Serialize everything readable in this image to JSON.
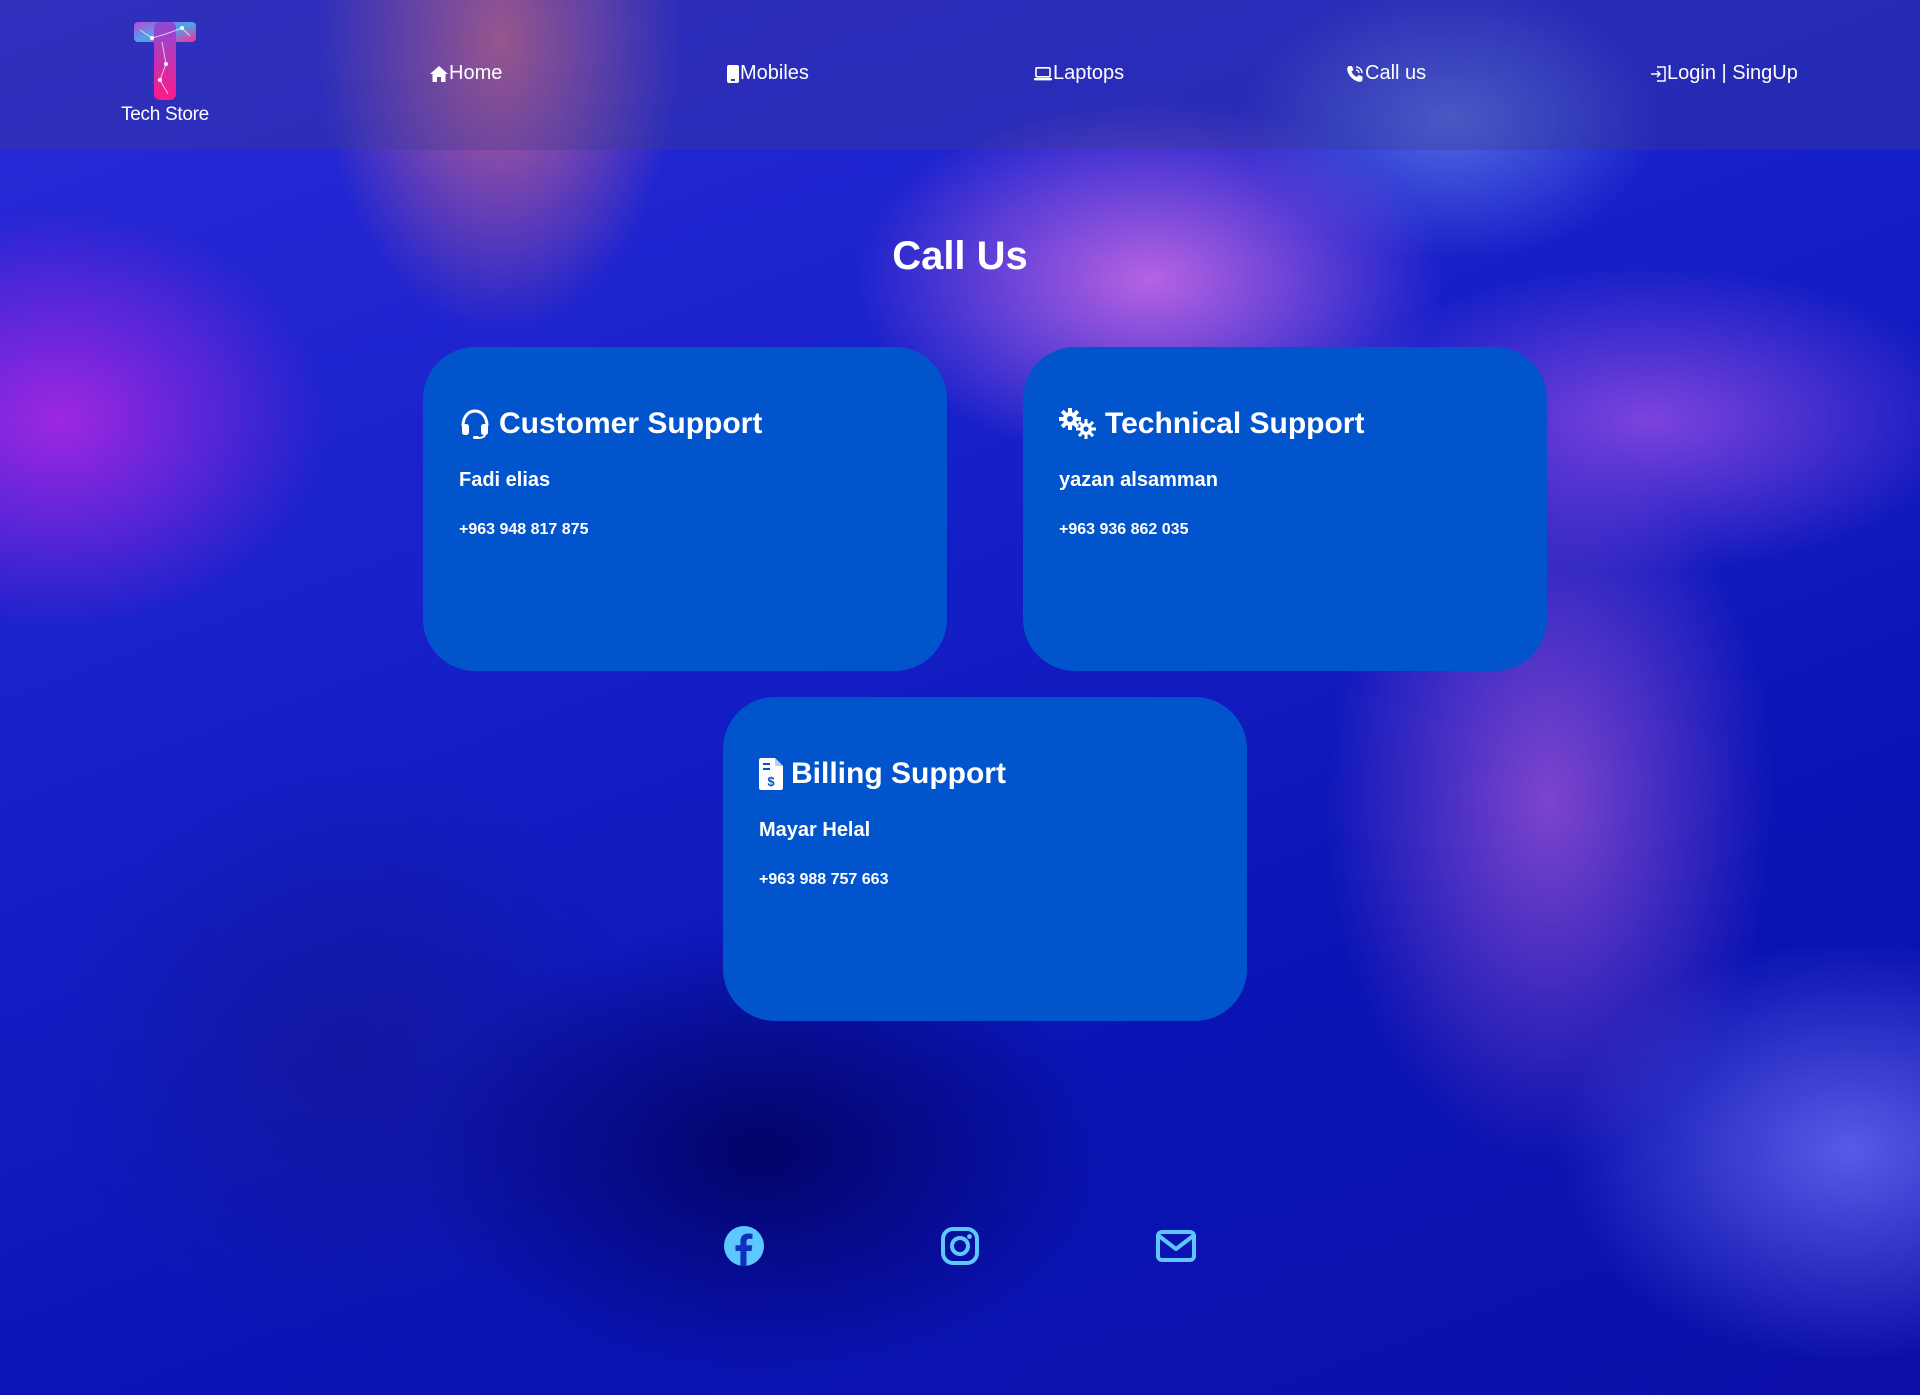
{
  "brand": {
    "name": "Tech Store"
  },
  "nav": [
    {
      "label": "Home",
      "icon": "home-icon"
    },
    {
      "label": "Mobiles",
      "icon": "mobile-icon"
    },
    {
      "label": "Laptops",
      "icon": "laptop-icon"
    },
    {
      "label": "Call us",
      "icon": "phone-icon"
    },
    {
      "label": "Login | SingUp",
      "icon": "login-icon"
    }
  ],
  "page": {
    "title": "Call Us"
  },
  "cards": [
    {
      "title": "Customer Support",
      "name": "Fadi elias",
      "phone": "+963 948 817 875",
      "icon": "headset-icon"
    },
    {
      "title": "Technical Support",
      "name": "yazan alsamman",
      "phone": "+963 936 862 035",
      "icon": "gears-icon"
    },
    {
      "title": "Billing Support",
      "name": "Mayar Helal",
      "phone": "+963 988 757 663",
      "icon": "invoice-icon"
    }
  ],
  "social": [
    {
      "icon": "facebook-icon"
    },
    {
      "icon": "instagram-icon"
    },
    {
      "icon": "envelope-icon"
    }
  ],
  "colors": {
    "card": "#0254cc",
    "social_icon": "#5cc8ff",
    "text": "#ffffff"
  }
}
